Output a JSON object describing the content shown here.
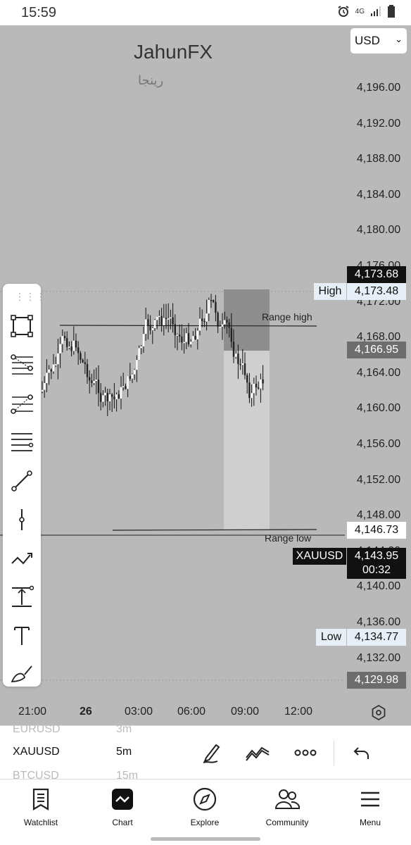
{
  "status_bar": {
    "time": "15:59",
    "network": "4G"
  },
  "chart": {
    "brand": "JahunFX",
    "brand_subtitle": "رینجا",
    "currency": "USD",
    "price_axis": [
      "4,196.00",
      "4,192.00",
      "4,188.00",
      "4,184.00",
      "4,180.00",
      "4,176.00",
      "4,172.00",
      "4,168.00",
      "4,164.00",
      "4,160.00",
      "4,156.00",
      "4,152.00",
      "4,148.00",
      "4,144.00",
      "4,140.00",
      "4,136.00",
      "4,132.00"
    ],
    "tags": {
      "last_high": "4,173.68",
      "high_label": "High",
      "high_value": "4,173.48",
      "range_high_price": "4,166.95",
      "range_low_price": "4,146.73",
      "symbol": "XAUUSD",
      "current_price": "4,143.95",
      "countdown": "00:32",
      "low_label": "Low",
      "low_value": "4,134.77",
      "bottom_price": "4,129.98"
    },
    "annotations": {
      "range_high": "Range high",
      "range_low": "Range low"
    },
    "time_axis": [
      "21:00",
      "26",
      "03:00",
      "06:00",
      "09:00",
      "12:00"
    ],
    "colors": {
      "background": "#b9b9b9",
      "candle": "#ffffff",
      "box_dark": "#8e8e8e",
      "box_light": "#cfcfcf"
    }
  },
  "drawing_tools": [
    "rectangle-icon",
    "fib-retracement-icon",
    "fib-extension-icon",
    "horizontal-lines-icon",
    "trend-line-icon",
    "vertical-line-icon",
    "path-icon",
    "price-range-icon",
    "text-icon",
    "brush-icon"
  ],
  "bottom_panel": {
    "symbols": [
      "EURUSD",
      "XAUUSD",
      "BTCUSD"
    ],
    "timeframes": [
      "3m",
      "5m",
      "15m"
    ],
    "selected_symbol": "XAUUSD",
    "selected_timeframe": "5m",
    "actions": [
      "draw-icon",
      "indicators-icon",
      "more-icon",
      "undo-icon"
    ]
  },
  "nav": [
    {
      "label": "Watchlist",
      "icon": "watchlist-icon"
    },
    {
      "label": "Chart",
      "icon": "chart-icon"
    },
    {
      "label": "Explore",
      "icon": "compass-icon"
    },
    {
      "label": "Community",
      "icon": "community-icon"
    },
    {
      "label": "Menu",
      "icon": "menu-icon"
    }
  ]
}
